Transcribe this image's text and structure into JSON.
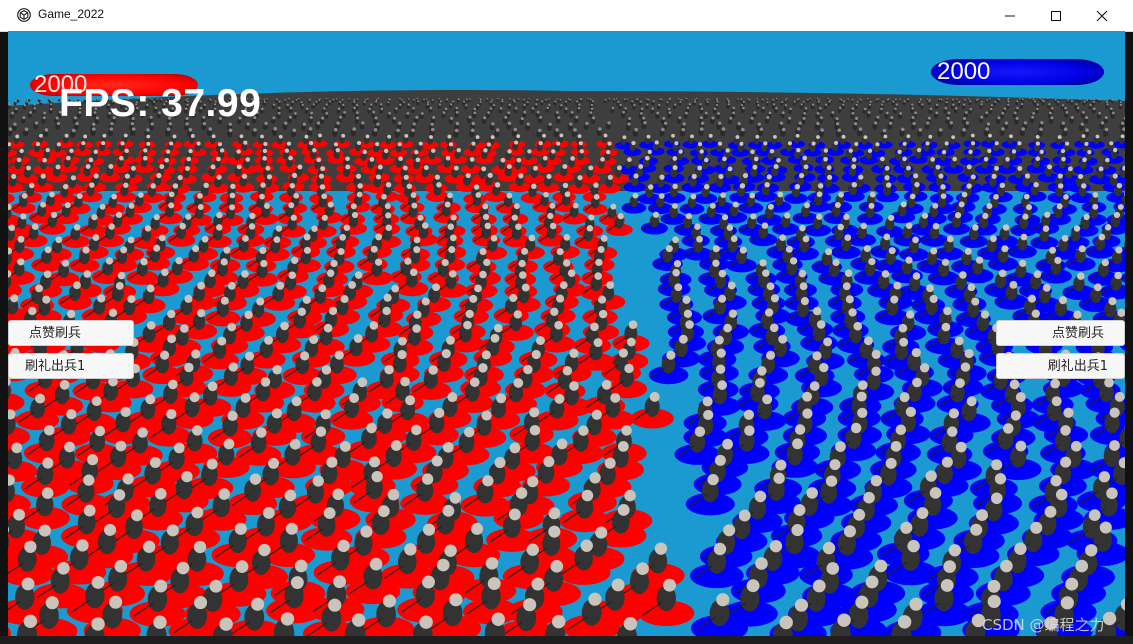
{
  "window": {
    "title": "Game_2022",
    "icon": "unity-icon",
    "controls": [
      "minimize-icon",
      "maximize-icon",
      "close-icon"
    ]
  },
  "hud": {
    "red_team_hp": "2000",
    "blue_team_hp": "2000",
    "fps_text": "FPS: 37.99",
    "colors": {
      "red": "#ff0000",
      "blue": "#0000ff",
      "ground": "#1a9ad0"
    }
  },
  "left_panel": {
    "like_button": "点赞刷兵",
    "gift_button": "刷礼出兵1"
  },
  "right_panel": {
    "like_button": "点赞刷兵",
    "gift_button": "刷礼出兵1"
  },
  "watermark": "CSDN @编程之力"
}
